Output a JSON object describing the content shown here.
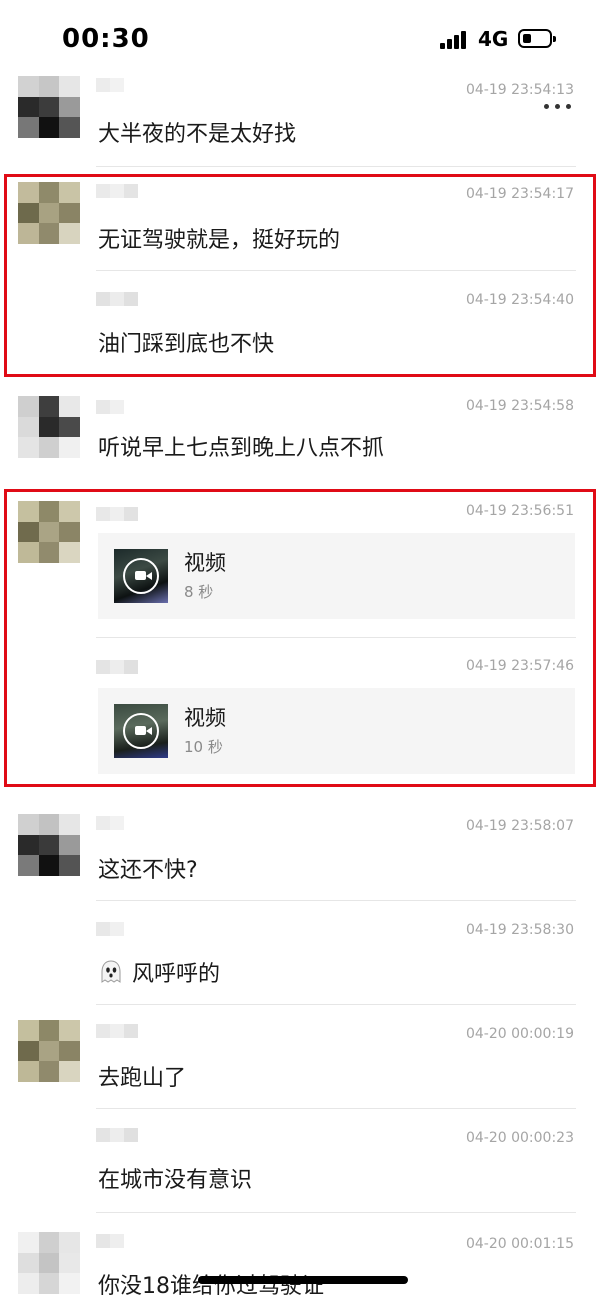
{
  "status_bar": {
    "time": "00:30",
    "network": "4G",
    "battery_level": 0.3
  },
  "header": {
    "more_icon": "more-dots-icon"
  },
  "messages": [
    {
      "timestamp": "04-19 23:54:13",
      "text": "大半夜的不是太好找"
    },
    {
      "timestamp": "04-19 23:54:17",
      "text": "无证驾驶就是，挺好玩的"
    },
    {
      "timestamp": "04-19 23:54:40",
      "text": "油门踩到底也不快"
    },
    {
      "timestamp": "04-19 23:54:58",
      "text": "听说早上七点到晚上八点不抓"
    },
    {
      "timestamp": "04-19 23:56:51",
      "video_title": "视频",
      "video_duration": "8 秒"
    },
    {
      "timestamp": "04-19 23:57:46",
      "video_title": "视频",
      "video_duration": "10 秒"
    },
    {
      "timestamp": "04-19 23:58:07",
      "text": "这还不快?"
    },
    {
      "timestamp": "04-19 23:58:30",
      "text": "风呼呼的",
      "emoji": "ghost-emoji"
    },
    {
      "timestamp": "04-20 00:00:19",
      "text": "去跑山了"
    },
    {
      "timestamp": "04-20 00:00:23",
      "text": "在城市没有意识"
    },
    {
      "timestamp": "04-20 00:01:15",
      "text": "你没18谁给你过驾驶证"
    }
  ],
  "colors": {
    "highlight": "#e00b16",
    "timestamp": "#a5a5a5",
    "divider": "#e6e6e6",
    "card_bg": "#f5f5f5"
  }
}
